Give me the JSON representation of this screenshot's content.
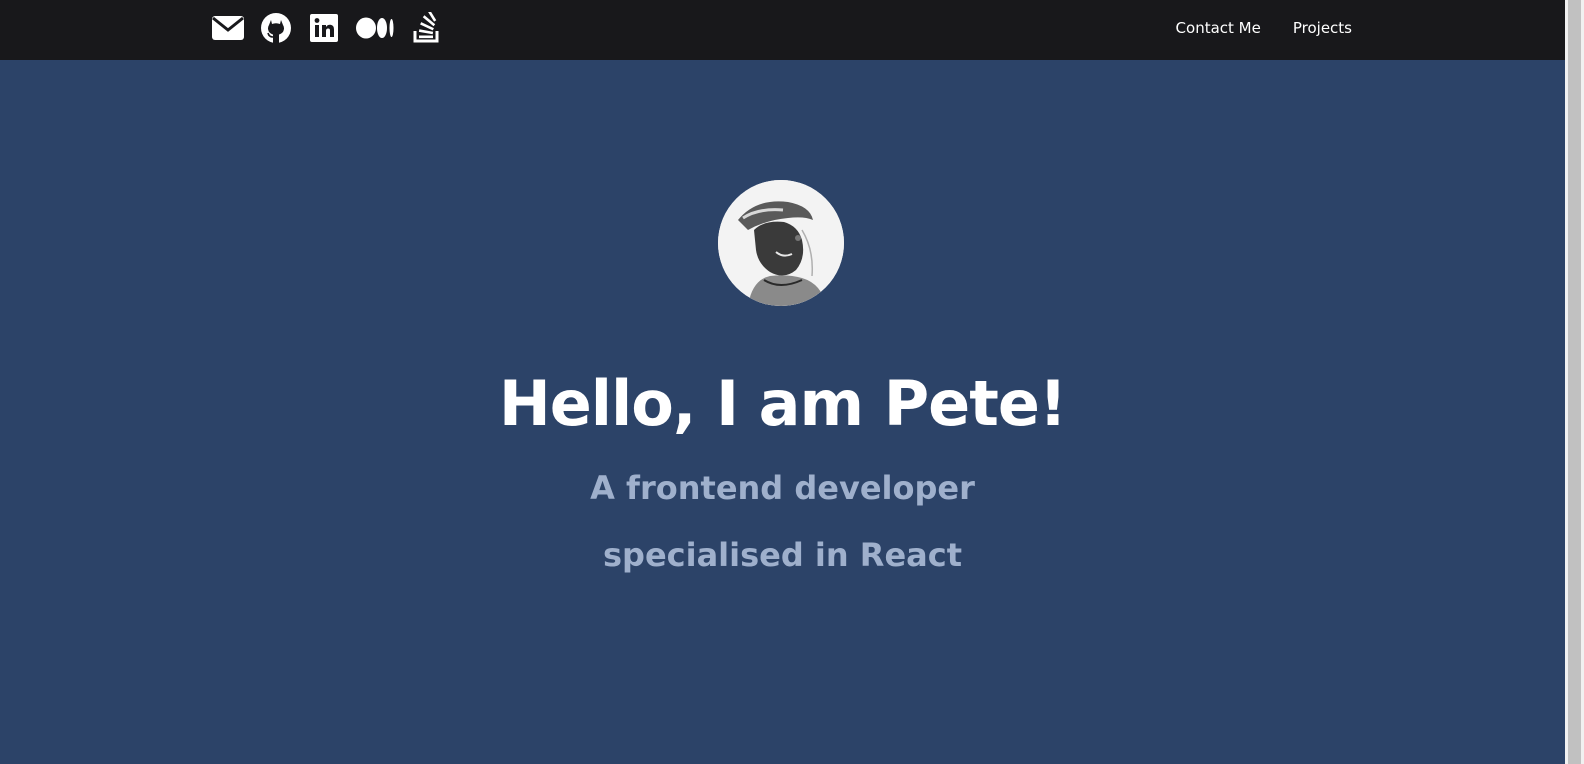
{
  "nav": {
    "social_icons": [
      "mail-icon",
      "github-icon",
      "linkedin-icon",
      "medium-icon",
      "stackoverflow-icon"
    ],
    "links": [
      "Contact Me",
      "Projects"
    ]
  },
  "hero": {
    "avatar": "profile-photo",
    "title": "Hello, I am Pete!",
    "subtitle_line1": "A frontend developer",
    "subtitle_line2": "specialised in React"
  },
  "colors": {
    "navbar_bg": "#18181b",
    "page_bg": "#2c4368",
    "title": "#ffffff",
    "subtitle": "#9fb0cc"
  }
}
